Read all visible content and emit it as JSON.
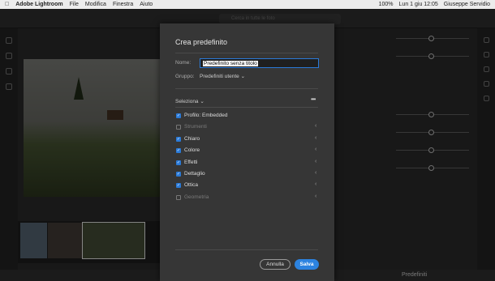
{
  "menubar": {
    "apple_icon": "apple-icon",
    "app_name": "Adobe Lightroom",
    "menus": [
      "File",
      "Modifica",
      "Finestra",
      "Aiuto"
    ],
    "battery": "100%",
    "datetime": "Lun 1 giu  12:05",
    "user": "Giuseppe Servidio"
  },
  "search": {
    "placeholder": "Cerca in tutte le foto"
  },
  "bottom": {
    "presets_label": "Predefiniti"
  },
  "dialog": {
    "title": "Crea predefinito",
    "name_label": "Nome:",
    "name_value": "Predefinito senza titolo",
    "group_label": "Gruppo:",
    "group_value": "Predefiniti utente",
    "select_label": "Seleziona",
    "more": "•••",
    "items": [
      {
        "label": "Profilo: Embedded",
        "checked": true,
        "chevron": false
      },
      {
        "label": "Strumenti",
        "checked": false,
        "chevron": true
      },
      {
        "label": "Chiaro",
        "checked": true,
        "chevron": true
      },
      {
        "label": "Colore",
        "checked": true,
        "chevron": true
      },
      {
        "label": "Effetti",
        "checked": true,
        "chevron": true
      },
      {
        "label": "Dettaglio",
        "checked": true,
        "chevron": true
      },
      {
        "label": "Ottica",
        "checked": true,
        "chevron": true
      },
      {
        "label": "Geometria",
        "checked": false,
        "chevron": true
      }
    ],
    "cancel_label": "Annulla",
    "save_label": "Salva",
    "accent": "#2c83e0"
  }
}
